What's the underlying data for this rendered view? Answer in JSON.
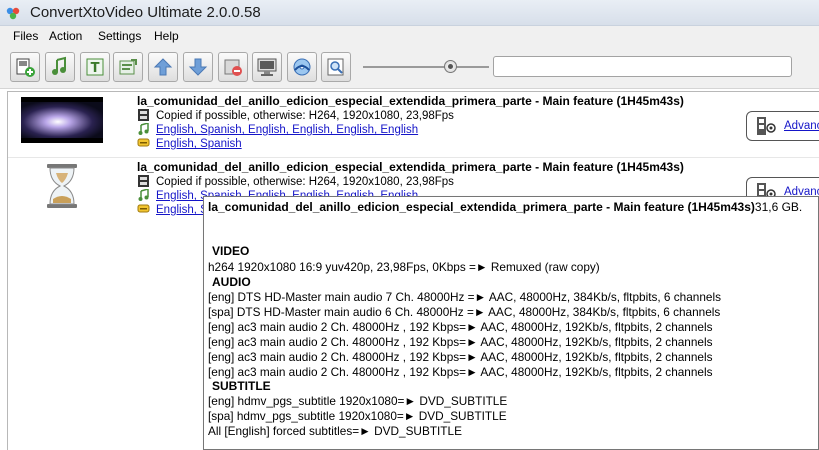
{
  "window": {
    "title": "ConvertXtoVideo Ultimate 2.0.0.58"
  },
  "menu": [
    "Files",
    "Action",
    "Settings",
    "Help"
  ],
  "toolbar": {
    "buttons": [
      {
        "name": "add-files-button",
        "icon": "add-video-icon"
      },
      {
        "name": "add-audio-button",
        "icon": "add-audio-icon"
      },
      {
        "name": "add-subtitle-button",
        "icon": "add-text-icon"
      },
      {
        "name": "edit-button",
        "icon": "edit-icon"
      },
      {
        "name": "move-up-button",
        "icon": "arrow-up-icon"
      },
      {
        "name": "move-down-button",
        "icon": "arrow-down-icon"
      },
      {
        "name": "remove-button",
        "icon": "remove-icon"
      },
      {
        "name": "preview-button",
        "icon": "preview-icon"
      },
      {
        "name": "convert-button",
        "icon": "burn-disc-icon"
      },
      {
        "name": "search-button",
        "icon": "magnifier-icon"
      }
    ],
    "zoom_slider_fraction": 0.72,
    "search_value": ""
  },
  "items": [
    {
      "title": "la_comunidad_del_anillo_edicion_especial_extendida_primera_parte - Main feature (1H45m43s)",
      "video_line": "Copied if possible, otherwise: H264, 1920x1080, 23,98Fps",
      "audio_line": "English, Spanish, English, English, English, English",
      "subtitle_line": "English, Spanish",
      "advanced_label": "Advanc",
      "thumbnail": "movie-frame"
    },
    {
      "title": "la_comunidad_del_anillo_edicion_especial_extendida_primera_parte - Main feature (1H45m43s)",
      "video_line": "Copied if possible, otherwise: H264, 1920x1080, 23,98Fps",
      "audio_line": "English, Spanish, English, English, English, English",
      "subtitle_line": "English, Sp",
      "advanced_label": "Advanc",
      "thumbnail": "hourglass-icon"
    }
  ],
  "tooltip": {
    "title": "la_comunidad_del_anillo_edicion_especial_extendida_primera_parte - Main feature (1H45m43s)",
    "size": "31,6 GB.",
    "video_header": "VIDEO",
    "video_lines": [
      "h264 1920x1080 16:9 yuv420p, 23,98Fps, 0Kbps =► Remuxed (raw copy)"
    ],
    "audio_header": "AUDIO",
    "audio_lines": [
      "[eng] DTS HD-Master main audio 7 Ch. 48000Hz =► AAC, 48000Hz, 384Kb/s, fltpbits, 6 channels",
      "[spa] DTS HD-Master main audio 6 Ch. 48000Hz =► AAC, 48000Hz, 384Kb/s, fltpbits, 6 channels",
      "[eng] ac3 main audio 2 Ch. 48000Hz , 192 Kbps=► AAC, 48000Hz, 192Kb/s, fltpbits, 2 channels",
      "[eng] ac3 main audio 2 Ch. 48000Hz , 192 Kbps=► AAC, 48000Hz, 192Kb/s, fltpbits, 2 channels",
      "[eng] ac3 main audio 2 Ch. 48000Hz , 192 Kbps=► AAC, 48000Hz, 192Kb/s, fltpbits, 2 channels",
      "[eng] ac3 main audio 2 Ch. 48000Hz , 192 Kbps=► AAC, 48000Hz, 192Kb/s, fltpbits, 2 channels"
    ],
    "subtitle_header": "SUBTITLE",
    "subtitle_lines": [
      "[eng] hdmv_pgs_subtitle 1920x1080=► DVD_SUBTITLE",
      "[spa] hdmv_pgs_subtitle 1920x1080=► DVD_SUBTITLE",
      "All [English] forced subtitles=► DVD_SUBTITLE"
    ]
  }
}
